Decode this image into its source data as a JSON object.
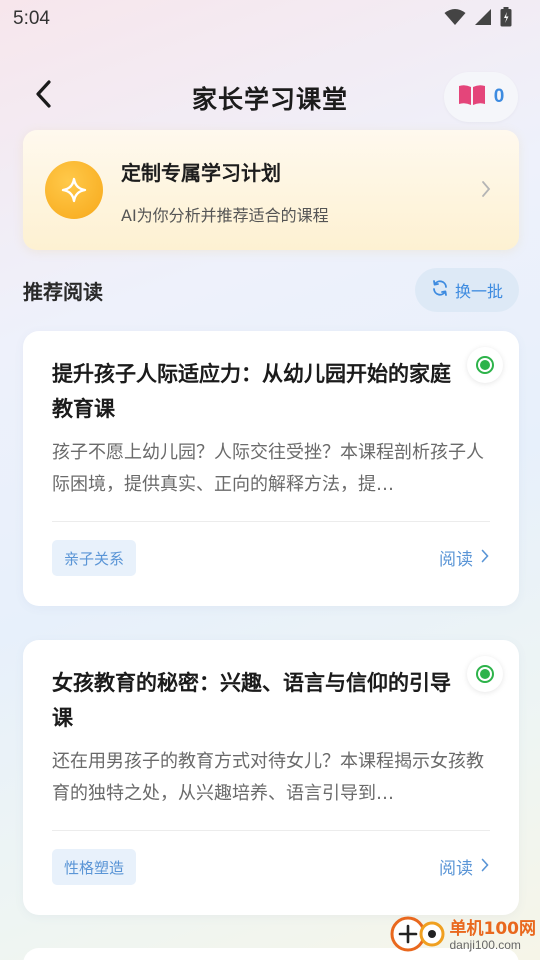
{
  "status_bar": {
    "time": "5:04",
    "icons": [
      "wifi-icon",
      "signal-icon",
      "battery-icon"
    ]
  },
  "header": {
    "title": "家长学习课堂",
    "book_count": "0",
    "icons": [
      "back-arrow-icon",
      "book-icon"
    ]
  },
  "plan_card": {
    "title": "定制专属学习计划",
    "subtitle": "AI为你分析并推荐适合的课程",
    "icon": "sparkle-icon"
  },
  "recommend": {
    "section_title": "推荐阅读",
    "refresh_label": "换一批",
    "cards": [
      {
        "title": "提升孩子人际适应力：从幼儿园开始的家庭教育课",
        "description": "孩子不愿上幼儿园？人际交往受挫？本课程剖析孩子人际困境，提供真实、正向的解释方法，提…",
        "tag": "亲子关系",
        "read_label": "阅读"
      },
      {
        "title": "女孩教育的秘密：兴趣、语言与信仰的引导课",
        "description": "还在用男孩子的教育方式对待女儿？本课程揭示女孩教育的独特之处，从兴趣培养、语言引导到…",
        "tag": "性格塑造",
        "read_label": "阅读"
      }
    ]
  },
  "watermark": {
    "name": "单机100网",
    "url": "danji100.com"
  },
  "colors": {
    "accent_blue": "#3d8be0",
    "plan_icon_orange": "#f7a81a",
    "radio_green": "#2db34a",
    "book_pink": "#e4457a"
  }
}
